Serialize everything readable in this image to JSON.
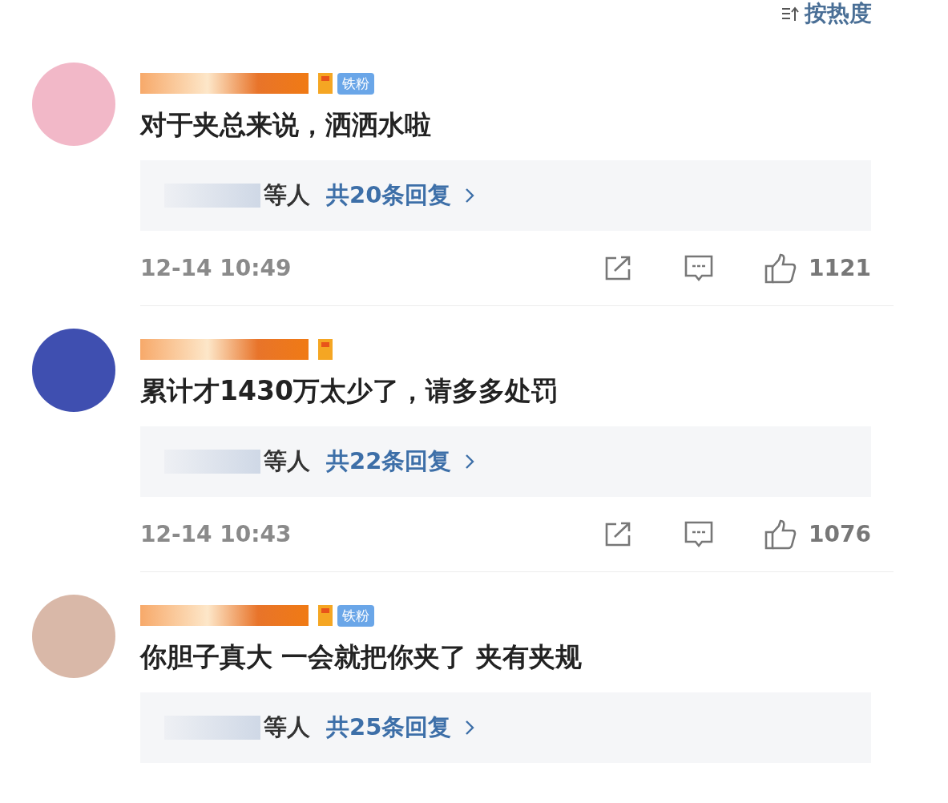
{
  "sort": {
    "label": "按热度"
  },
  "comments": [
    {
      "badge": {
        "fan": true,
        "label": "铁粉"
      },
      "text": "对于夹总来说，洒洒水啦",
      "replies": {
        "names_suffix": "等人",
        "count_text": "共20条回复"
      },
      "time": "12-14 10:49",
      "likes": "1121"
    },
    {
      "badge": {
        "fan": false
      },
      "text": "累计才1430万太少了，请多多处罚",
      "replies": {
        "names_suffix": "等人",
        "count_text": "共22条回复"
      },
      "time": "12-14 10:43",
      "likes": "1076"
    },
    {
      "badge": {
        "fan": true,
        "label": "铁粉"
      },
      "text": "你胆子真大 一会就把你夹了 夹有夹规",
      "replies": {
        "names_suffix": "等人",
        "count_text": "共25条回复"
      }
    }
  ]
}
